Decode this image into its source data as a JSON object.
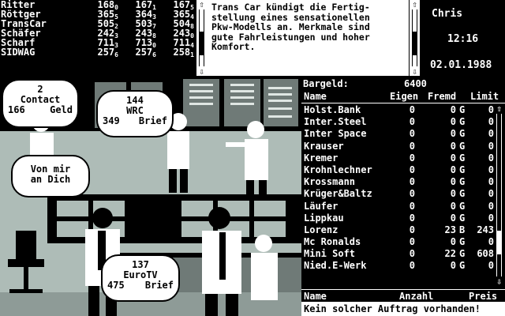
{
  "ticker": [
    {
      "name": "Ritter",
      "v1": "168",
      "s1": "0",
      "v2": "167",
      "s2": "1",
      "v3": "167",
      "s3": "5"
    },
    {
      "name": "Röttger",
      "v1": "365",
      "s1": "5",
      "v2": "364",
      "s2": "3",
      "v3": "365",
      "s3": "4"
    },
    {
      "name": "TransCar",
      "v1": "505",
      "s1": "2",
      "v2": "503",
      "s2": "7",
      "v3": "504",
      "s3": "8"
    },
    {
      "name": "Schäfer",
      "v1": "242",
      "s1": "3",
      "v2": "243",
      "s2": "8",
      "v3": "243",
      "s3": "0"
    },
    {
      "name": "Scharf",
      "v1": "711",
      "s1": "3",
      "v2": "713",
      "s2": "0",
      "v3": "711",
      "s3": "4"
    },
    {
      "name": "SIDWAG",
      "v1": "257",
      "s1": "6",
      "v2": "257",
      "s2": "6",
      "v3": "258",
      "s3": "1"
    }
  ],
  "news": "Trans Car kündigt die Fertig-stellung eines sensationellen Pkw-Modells an. Merkmale sind gute Fahrleistungen und hoher Komfort.",
  "news_lines": [
    "Trans Car kündigt die Fertig-",
    "stellung eines sensationellen",
    "Pkw-Modells an. Merkmale sind",
    "gute Fahrleistungen und hoher",
    "Komfort."
  ],
  "clock": {
    "player": "Chris",
    "time": "12:16",
    "date": "02.01.1988"
  },
  "bubbles": {
    "contact": {
      "count": "2",
      "name": "Contact",
      "amount": "166",
      "kind": "Geld"
    },
    "wrc": {
      "count": "144",
      "name": "WRC",
      "amount": "349",
      "kind": "Brief"
    },
    "dich": {
      "line1": "Von mir",
      "line2": "an Dich"
    },
    "eurotv": {
      "count": "137",
      "name": "EuroTV",
      "amount": "475",
      "kind": "Brief"
    }
  },
  "panel": {
    "cash_label": "Bargeld:",
    "cash_value": "6400",
    "headers": {
      "name": "Name",
      "own": "Eigen",
      "foreign": "Fremd",
      "limit": "Limit"
    },
    "rows": [
      {
        "name": "Holst.Bank",
        "own": "0",
        "foreign": "0",
        "status": "G",
        "limit": "0"
      },
      {
        "name": "Inter.Steel",
        "own": "0",
        "foreign": "0",
        "status": "G",
        "limit": "0"
      },
      {
        "name": "Inter Space",
        "own": "0",
        "foreign": "0",
        "status": "G",
        "limit": "0"
      },
      {
        "name": "Krauser",
        "own": "0",
        "foreign": "0",
        "status": "G",
        "limit": "0"
      },
      {
        "name": "Kremer",
        "own": "0",
        "foreign": "0",
        "status": "G",
        "limit": "0"
      },
      {
        "name": "Krohnlechner",
        "own": "0",
        "foreign": "0",
        "status": "G",
        "limit": "0"
      },
      {
        "name": "Krossmann",
        "own": "0",
        "foreign": "0",
        "status": "G",
        "limit": "0"
      },
      {
        "name": "Krüger&Baltz",
        "own": "0",
        "foreign": "0",
        "status": "G",
        "limit": "0"
      },
      {
        "name": "Läufer",
        "own": "0",
        "foreign": "0",
        "status": "G",
        "limit": "0"
      },
      {
        "name": "Lippkau",
        "own": "0",
        "foreign": "0",
        "status": "G",
        "limit": "0"
      },
      {
        "name": "Lorenz",
        "own": "0",
        "foreign": "23",
        "status": "B",
        "limit": "243"
      },
      {
        "name": "Mc Ronalds",
        "own": "0",
        "foreign": "0",
        "status": "G",
        "limit": "0"
      },
      {
        "name": "Mini Soft",
        "own": "0",
        "foreign": "22",
        "status": "G",
        "limit": "608"
      },
      {
        "name": "Nied.E-Werk",
        "own": "0",
        "foreign": "0",
        "status": "G",
        "limit": "0"
      }
    ],
    "footer": {
      "name": "Name",
      "qty": "Anzahl",
      "price": "Preis"
    },
    "status": "Kein solcher Auftrag vorhanden!"
  },
  "colors": {
    "scene": "#aebcb7",
    "dark": "#000000",
    "light": "#ffffff",
    "mid": "#6f7a77"
  }
}
